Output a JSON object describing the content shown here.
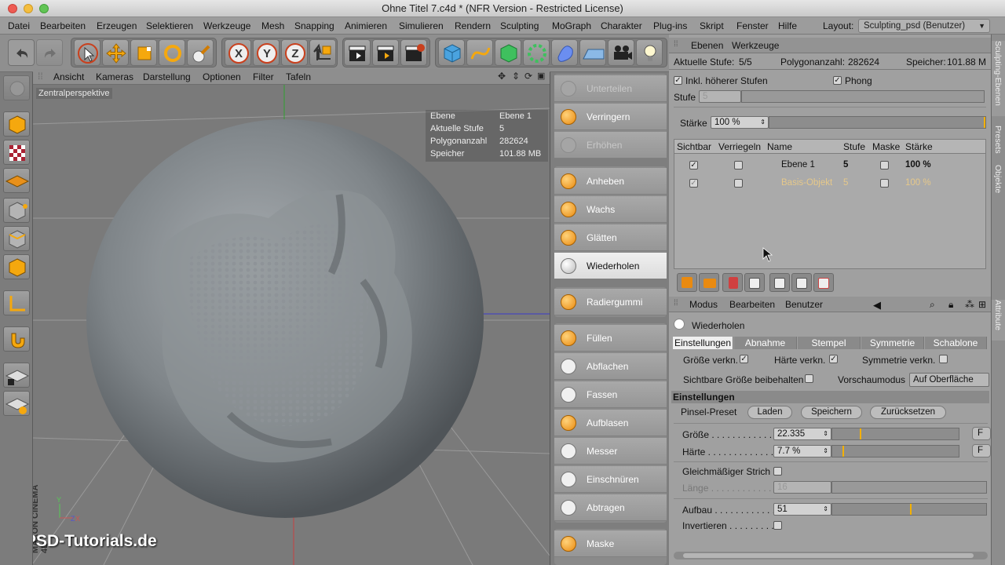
{
  "window": {
    "title": "Ohne Titel 7.c4d * (NFR Version - Restricted License)"
  },
  "menubar": {
    "items": [
      "Datei",
      "Bearbeiten",
      "Erzeugen",
      "Selektieren",
      "Werkzeuge",
      "Mesh",
      "Snapping",
      "Animieren",
      "Simulieren",
      "Rendern",
      "Sculpting",
      "MoGraph",
      "Charakter",
      "Plug-ins",
      "Skript",
      "Fenster",
      "Hilfe"
    ],
    "layout_label": "Layout:",
    "layout_value": "Sculpting_psd (Benutzer)"
  },
  "viewport": {
    "menu": [
      "Ansicht",
      "Kameras",
      "Darstellung",
      "Optionen",
      "Filter",
      "Tafeln"
    ],
    "label": "Zentralperspektive",
    "hud": [
      {
        "k": "Ebene",
        "v": "Ebene 1"
      },
      {
        "k": "Aktuelle Stufe",
        "v": "5"
      },
      {
        "k": "Polygonanzahl",
        "v": "282624"
      },
      {
        "k": "Speicher",
        "v": "101.88 MB"
      }
    ],
    "watermark": "PSD-Tutorials.de",
    "brand": "MAXON CINEMA 4D"
  },
  "brushes": {
    "items": [
      {
        "label": "Unterteilen",
        "state": "disabled"
      },
      {
        "label": "Verringern",
        "state": "normal"
      },
      {
        "label": "Erhöhen",
        "state": "disabled"
      },
      {
        "label": "Anheben",
        "state": "normal"
      },
      {
        "label": "Wachs",
        "state": "normal"
      },
      {
        "label": "Glätten",
        "state": "normal"
      },
      {
        "label": "Wiederholen",
        "state": "selected"
      },
      {
        "label": "Radiergummi",
        "state": "normal"
      },
      {
        "label": "Füllen",
        "state": "normal"
      },
      {
        "label": "Abflachen",
        "state": "normal"
      },
      {
        "label": "Fassen",
        "state": "normal"
      },
      {
        "label": "Aufblasen",
        "state": "normal"
      },
      {
        "label": "Messer",
        "state": "normal"
      },
      {
        "label": "Einschnüren",
        "state": "normal"
      },
      {
        "label": "Abtragen",
        "state": "normal"
      },
      {
        "label": "Maske",
        "state": "normal"
      }
    ]
  },
  "layers": {
    "tabs": [
      "Ebenen",
      "Werkzeuge"
    ],
    "current_level_label": "Aktuelle Stufe:",
    "current_level": "5/5",
    "polycount_label": "Polygonanzahl:",
    "polycount": "282624",
    "memory_label": "Speicher:",
    "memory": "101.88 M",
    "include_higher": "Inkl. höherer Stufen",
    "phong": "Phong",
    "level_label": "Stufe",
    "level_value": "5",
    "strength_label": "Stärke",
    "strength_value": "100 %",
    "columns": [
      "Sichtbar",
      "Verriegeln",
      "Name",
      "Stufe",
      "Maske",
      "Stärke"
    ],
    "rows": [
      {
        "name": "Ebene 1",
        "level": "5",
        "strength": "100 %"
      },
      {
        "name": "Basis-Objekt",
        "level": "5",
        "strength": "100 %"
      }
    ]
  },
  "attributes": {
    "menu": [
      "Modus",
      "Bearbeiten",
      "Benutzer"
    ],
    "tool_name": "Wiederholen",
    "tabs": [
      "Einstellungen",
      "Abnahme",
      "Stempel",
      "Symmetrie",
      "Schablone"
    ],
    "size_link": "Größe verkn.",
    "hardness_link": "Härte verkn.",
    "symmetry_link": "Symmetrie verkn.",
    "keep_visible_size": "Sichtbare Größe beibehalten",
    "preview_mode_label": "Vorschaumodus",
    "preview_mode_value": "Auf Oberfläche",
    "section": "Einstellungen",
    "preset_label": "Pinsel-Preset",
    "load": "Laden",
    "save": "Speichern",
    "reset": "Zurücksetzen",
    "size_label": "Größe . . . . . . . . . . . . .",
    "size_value": "22.335",
    "size_fraction": 0.22,
    "hardness_label": "Härte . . . . . . . . . . . . .",
    "hardness_value": "7.7 %",
    "hardness_fraction": 0.08,
    "even_stroke": "Gleichmäßiger Strich",
    "length_label": "Länge . . . . . . . . . . . . .",
    "length_value": "16",
    "buildup_label": "Aufbau . . . . . . . . . . . .",
    "buildup_value": "51",
    "buildup_fraction": 0.51,
    "invert_label": "Invertieren . . . . . . . . ."
  },
  "sidetabs": [
    "Sculpting-Ebenen",
    "Presets",
    "Objekte",
    "Attribute"
  ]
}
